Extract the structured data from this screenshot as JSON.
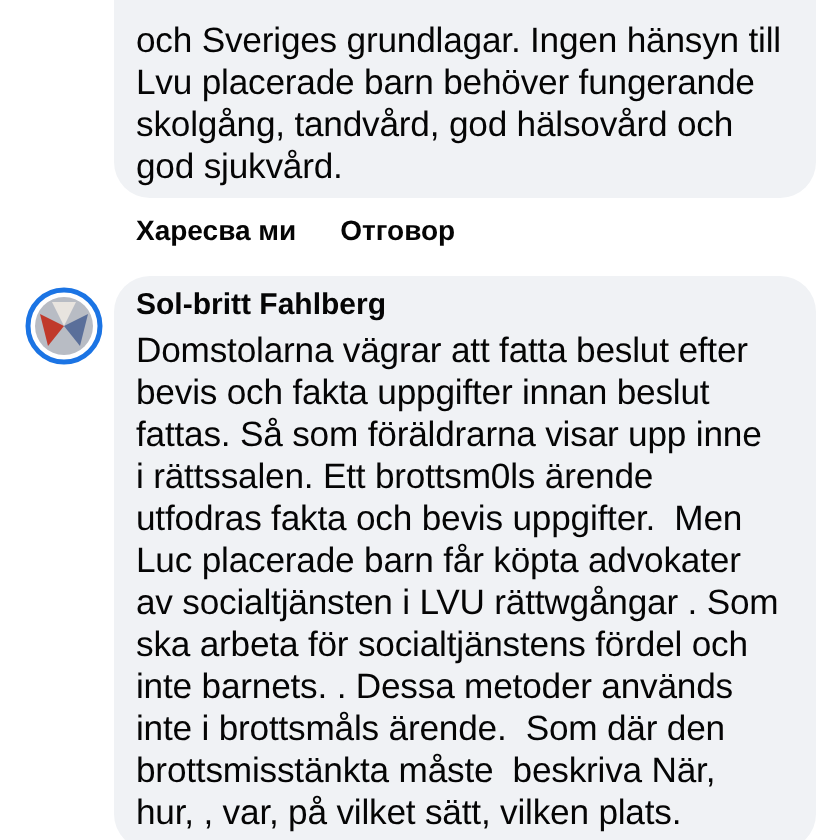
{
  "comments": [
    {
      "lines": [
        "och Sveriges grundlagar. Ingen hänsyn till",
        "Lvu placerade barn behöver fungerande",
        "skolgång, tandvård, god hälsovård och",
        "god sjukvård."
      ],
      "actions": [
        "Харесва ми",
        "Отговор"
      ]
    },
    {
      "author": "Sol-britt Fahlberg",
      "lines": [
        "Domstolarna vägrar att fatta beslut efter",
        "bevis och fakta uppgifter innan beslut",
        "fattas. Så som föräldrarna visar upp inne",
        "i rättssalen. Ett brottsm0ls ärende",
        "utfodras fakta och bevis uppgifter.  Men",
        "Luc placerade barn får köpta advokater",
        "av socialtjänsten i LVU rättwgångar . Som",
        "ska arbeta för socialtjänstens fördel och",
        "inte barnets. . Dessa metoder används",
        "inte i brottsmåls ärende.  Som där den",
        "brottsmisstänkta måste  beskriva När,",
        "hur, , var, på vilket sätt, vilken plats."
      ]
    }
  ]
}
